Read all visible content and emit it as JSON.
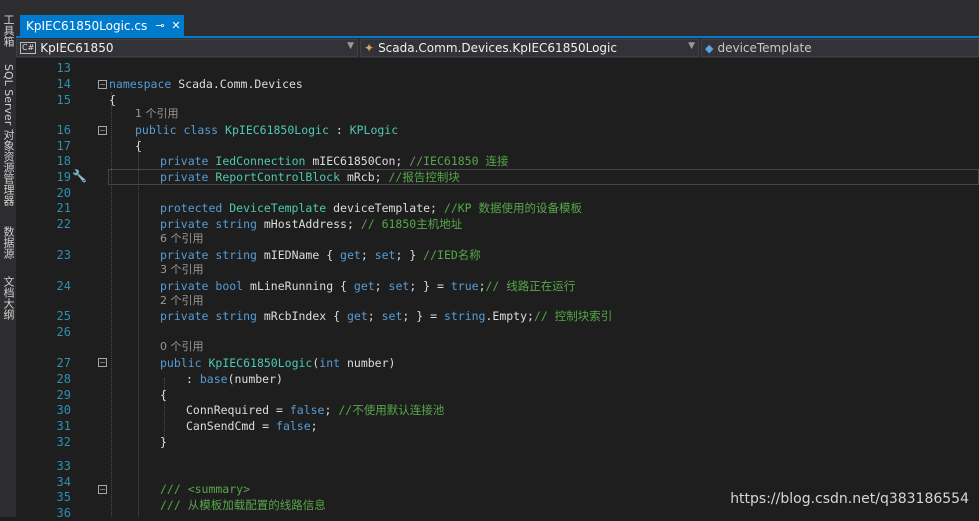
{
  "side_tabs": [
    "工具箱",
    "SQL Server 对象资源管理器",
    "数据源",
    "文档大纲"
  ],
  "tab": {
    "label": "KpIEC61850Logic.cs",
    "pin_icon": "pin-icon",
    "close_icon": "close-icon"
  },
  "nav": {
    "project_badge": "C#",
    "project": "KpIEC61850",
    "class": "Scada.Comm.Devices.KpIEC61850Logic",
    "member": "deviceTemplate"
  },
  "references": {
    "r1": "1 个引用",
    "r6": "6 个引用",
    "r3": "3 个引用",
    "r2": "2 个引用",
    "r0": "0 个引用"
  },
  "line_numbers": [
    "13",
    "14",
    "15",
    "16",
    "17",
    "18",
    "19",
    "20",
    "21",
    "22",
    "23",
    "24",
    "25",
    "26",
    "27",
    "28",
    "29",
    "30",
    "31",
    "32",
    "33",
    "34",
    "35",
    "36"
  ],
  "code": {
    "l14": [
      "namespace",
      " Scada.Comm.Devices"
    ],
    "l15": "{",
    "l16": [
      "public",
      " ",
      "class",
      " ",
      "KpIEC61850Logic",
      " : ",
      "KPLogic"
    ],
    "l17": "{",
    "l18": [
      "private",
      " ",
      "IedConnection",
      " mIEC61850Con; ",
      "//IEC61850 连接"
    ],
    "l19": [
      "private",
      " ",
      "ReportControlBlock",
      " mRcb; ",
      "//报告控制块"
    ],
    "l21": [
      "protected",
      " ",
      "DeviceTemplate",
      " deviceTemplate; ",
      "//KP 数据使用的设备模板"
    ],
    "l22": [
      "private",
      " ",
      "string",
      " mHostAddress; ",
      "// 61850主机地址"
    ],
    "l23": [
      "private",
      " ",
      "string",
      " mIEDName { ",
      "get",
      "; ",
      "set",
      "; } ",
      "//IED名称"
    ],
    "l24": [
      "private",
      " ",
      "bool",
      " mLineRunning { ",
      "get",
      "; ",
      "set",
      "; } = ",
      "true",
      ";",
      "// 线路正在运行"
    ],
    "l25": [
      "private",
      " ",
      "string",
      " mRcbIndex { ",
      "get",
      "; ",
      "set",
      "; } = ",
      "string",
      ".Empty;",
      "// 控制块索引"
    ],
    "l27": [
      "public",
      " ",
      "KpIEC61850Logic",
      "(",
      "int",
      " number)"
    ],
    "l28": [
      ": ",
      "base",
      "(number)"
    ],
    "l29": "{",
    "l30": [
      "ConnRequired = ",
      "false",
      "; ",
      "//不使用默认连接池"
    ],
    "l31": [
      "CanSendCmd = ",
      "false",
      ";"
    ],
    "l32": "}",
    "l35": "/// <summary>",
    "l36": "/// 从模板加载配置的线路信息"
  },
  "watermark": "https://blog.csdn.net/q383186554",
  "colors": {
    "keyword": "#569cd6",
    "type": "#4ec9b0",
    "comment": "#57a64a",
    "accent": "#007acc"
  }
}
